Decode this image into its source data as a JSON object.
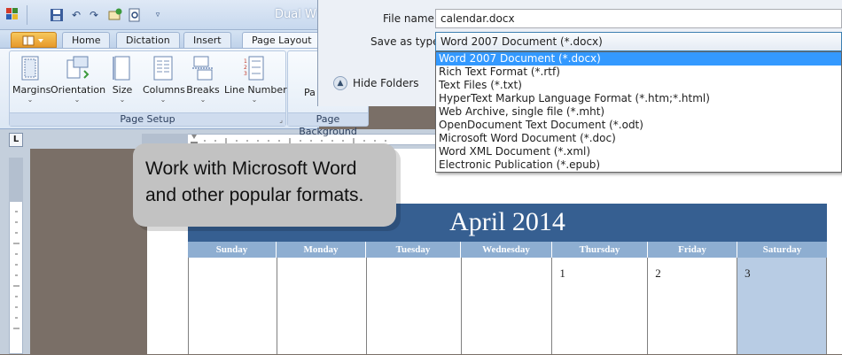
{
  "app": {
    "title": "Dual W",
    "quick_access": [
      "save-icon",
      "undo-icon",
      "redo-icon",
      "email-icon",
      "print-preview-icon",
      "customize-icon"
    ]
  },
  "tabs": [
    {
      "label": "Home"
    },
    {
      "label": "Dictation"
    },
    {
      "label": "Insert"
    },
    {
      "label": "Page Layout",
      "active": true
    }
  ],
  "ribbon": {
    "page_setup": {
      "label": "Page Setup",
      "buttons": [
        {
          "label": "Margins",
          "icon": "margins-icon"
        },
        {
          "label": "Orientation",
          "icon": "orientation-icon"
        },
        {
          "label": "Size",
          "icon": "size-icon"
        },
        {
          "label": "Columns",
          "icon": "columns-icon"
        },
        {
          "label": "Breaks",
          "icon": "breaks-icon"
        },
        {
          "label": "Line Numbers",
          "icon": "line-numbers-icon"
        }
      ]
    },
    "page_background": {
      "label": "Page Background",
      "button_partial": "Pa"
    }
  },
  "callout": {
    "line1": "Work with Microsoft Word",
    "line2": "and other popular formats."
  },
  "calendar": {
    "title": "April 2014",
    "days": [
      "Sunday",
      "Monday",
      "Tuesday",
      "Wednesday",
      "Thursday",
      "Friday",
      "Saturday"
    ],
    "first_row": [
      "",
      "",
      "",
      "",
      "1",
      "2",
      "3"
    ]
  },
  "save_dialog": {
    "file_name_label": "File name:",
    "file_name_value": "calendar.docx",
    "save_type_label": "Save as type:",
    "save_type_value": "Word 2007 Document (*.docx)",
    "hide_folders": "Hide Folders",
    "options": [
      "Word 2007 Document (*.docx)",
      "Rich Text Format (*.rtf)",
      "Text Files (*.txt)",
      "HyperText Markup Language Format (*.htm;*.html)",
      "Web Archive, single file (*.mht)",
      "OpenDocument Text Document (*.odt)",
      "Microsoft Word Document (*.doc)",
      "Word XML Document (*.xml)",
      "Electronic Publication (*.epub)"
    ],
    "selected_index": 0
  },
  "colors": {
    "calendar_header": "#365f91",
    "calendar_days": "#8eaed1",
    "saturday": "#b8cce4",
    "selection": "#3399ff"
  }
}
